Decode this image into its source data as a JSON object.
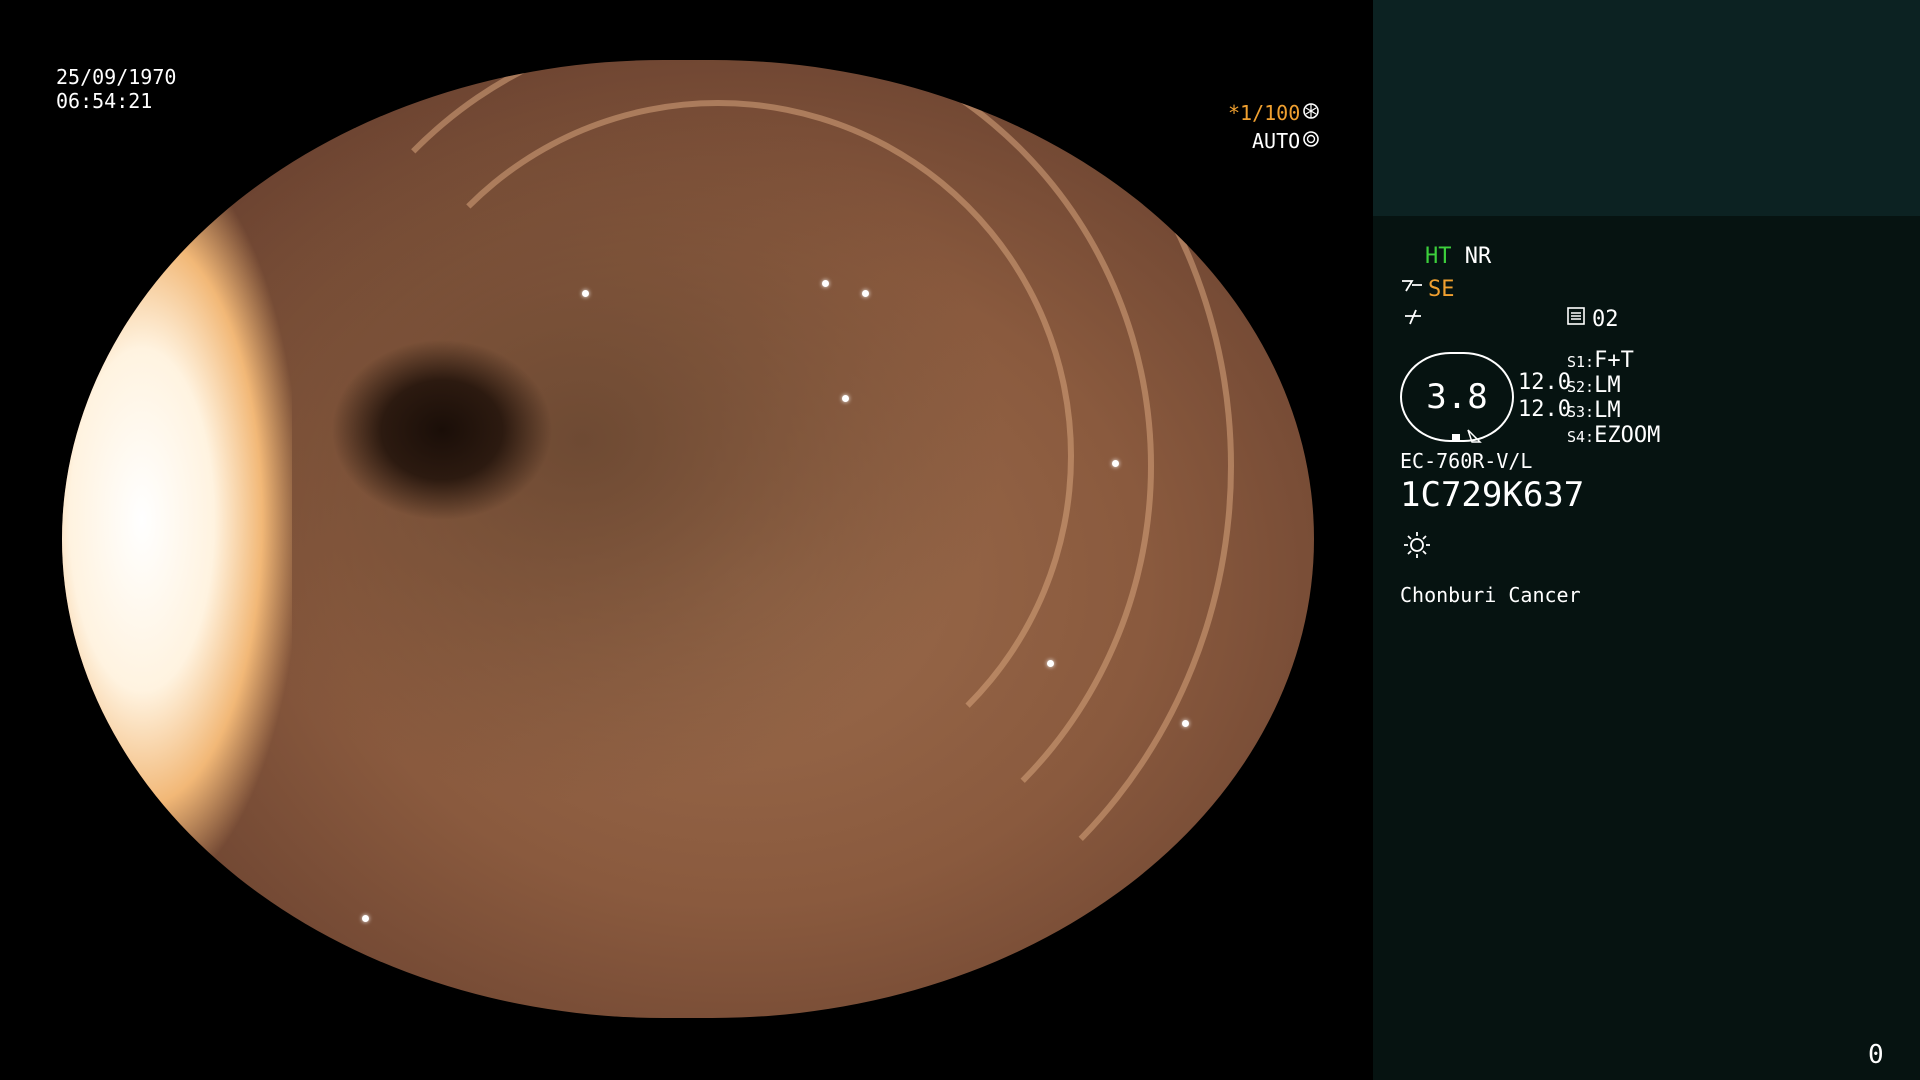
{
  "video": {
    "date": "25/09/1970",
    "time": "06:54:21",
    "shutter": "*1/100",
    "shutter_icon": "aperture-icon",
    "iris": "AUTO",
    "iris_icon": "iris-icon"
  },
  "panel": {
    "ht": "HT",
    "nr": "NR",
    "se": "SE",
    "mode_icon": "enhance-icon",
    "filter_icon": "filter-icon",
    "memory_icon": "memory-icon",
    "memory_num": "02",
    "level": "3.8",
    "values": [
      "12.0",
      "12.0"
    ],
    "switches": [
      {
        "key": "S1:",
        "value": "F+T"
      },
      {
        "key": "S2:",
        "value": "LM"
      },
      {
        "key": "S3:",
        "value": "LM"
      },
      {
        "key": "S4:",
        "value": "EZOOM"
      }
    ],
    "scope_model": "EC-760R-V/L",
    "serial": "1C729K637",
    "light_icon": "sun-icon",
    "hospital": "Chonburi Cancer",
    "counter": "0"
  },
  "colors": {
    "panel_bg": "#061311",
    "panel_top_bg": "#0c2222",
    "ht_color": "#3ccf3c",
    "se_color": "#f0a030",
    "shutter_color": "#f0a030"
  }
}
